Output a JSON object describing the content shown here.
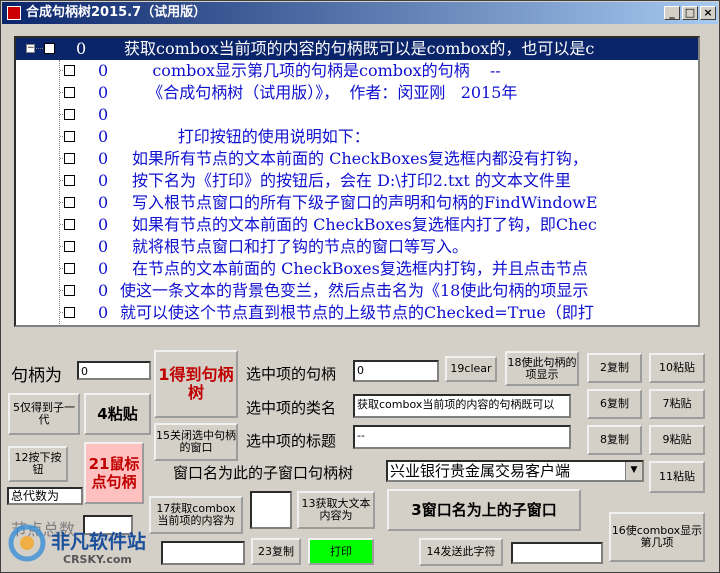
{
  "window": {
    "title": "合成句柄树2015.7（试用版）",
    "min_label": "_",
    "max_label": "□",
    "close_label": "×"
  },
  "tree": {
    "expander": "−",
    "rows": [
      {
        "num": "0",
        "text": "获取combox当前项的内容的句柄既可以是combox的，也可以是c"
      },
      {
        "num": "0",
        "text": "    combox显示第几项的句柄是combox的句柄    --"
      },
      {
        "num": "0",
        "text": "   《合成句柄树（试用版）》，  作者：闵亚刚   2015年"
      },
      {
        "num": "0",
        "text": ""
      },
      {
        "num": "0",
        "text": "         打印按钮的使用说明如下："
      },
      {
        "num": "0",
        "text": "如果所有节点的文本前面的 CheckBoxes复选框内都没有打钩，"
      },
      {
        "num": "0",
        "text": "按下名为《打印》的按钮后，会在 D:\\打印2.txt 的文本文件里"
      },
      {
        "num": "0",
        "text": "写入根节点窗口的所有下级子窗口的声明和句柄的FindWindowE"
      },
      {
        "num": "0",
        "text": "如果有节点的文本前面的 CheckBoxes复选框内打了钩，即Chec"
      },
      {
        "num": "0",
        "text": "就将根节点窗口和打了钩的节点的窗口等写入。"
      },
      {
        "num": "0",
        "text": "在节点的文本前面的 CheckBoxes复选框内打钩，并且点击节点"
      },
      {
        "num": "0",
        "text": "使这一条文本的背景色变兰，然后点击名为《18使此句柄的项显示"
      },
      {
        "num": "0",
        "text": "就可以使这个节点直到根节点的上级节点的Checked=True（即打"
      }
    ]
  },
  "controls": {
    "handle_label": "句柄为",
    "handle_value": "0",
    "btn_get_child": "5仅得到子一代",
    "btn_paste4": "4粘贴",
    "btn_get_handle": "1得到句柄树",
    "sel_handle_label": "选中项的句柄",
    "sel_handle_value": "0",
    "btn_clear": "19clear",
    "btn_show_item": "18使此句柄的项显示",
    "sel_class_label": "选中项的类名",
    "sel_class_value": "获取combox当前项的内容的句柄既可以",
    "btn_close_selected": "15关闭选中句柄的窗口",
    "sel_title_label": "选中项的标题",
    "sel_title_value": "--",
    "btn_press": "12按下按钮",
    "btn_mouse_handle": "21鼠标点句柄",
    "total_label": "总代数为",
    "child_window_label": "窗口名为此的子窗口句柄树",
    "child_window_value": "兴业银行贵金属交易客户端",
    "btn_get_combox": "17获取combox当前项的内容为",
    "btn_get_large_text": "13获取大文本内容为",
    "btn_child_window": "3窗口名为上的子窗口",
    "node_total_label": "节点总数",
    "btn_copy23": "23复制",
    "btn_print": "打印",
    "btn_send_string": "14发送此字符",
    "btn_copy2": "2复制",
    "btn_paste10": "10粘贴",
    "btn_copy6": "6复制",
    "btn_paste7": "7粘贴",
    "btn_copy8": "8复制",
    "btn_paste9": "9粘贴",
    "btn_paste11": "11粘贴",
    "btn_combox_show": "16使combox显示第几项"
  },
  "watermark": {
    "name": "非凡软件站",
    "domain": "CRSKY.com"
  },
  "colors": {
    "tree_text": "#1010d0",
    "selection": "#0a246a",
    "red_text": "#c00000",
    "print_green": "#00ff00",
    "mouse_pink": "#ffc0c0"
  }
}
